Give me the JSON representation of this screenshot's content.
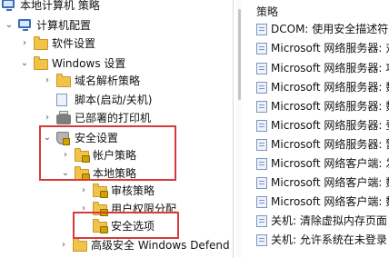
{
  "tree": {
    "root": "本地计算机 策略",
    "computer_config": "计算机配置",
    "software_settings": "软件设置",
    "windows_settings": "Windows 设置",
    "dns_policy": "域名解析策略",
    "scripts": "脚本(启动/关机)",
    "printers": "已部署的打印机",
    "security_settings": "安全设置",
    "account_policies": "帐户策略",
    "local_policies": "本地策略",
    "audit_policy": "审核策略",
    "user_rights": "用户权限分配",
    "security_options": "安全选项",
    "advanced_firewall": "高级安全 Windows Defend"
  },
  "right_panel": {
    "header": "策略",
    "items": [
      "DCOM: 使用安全描述符",
      "Microsoft 网络服务器: 对",
      "Microsoft 网络服务器: 攻",
      "Microsoft 网络服务器: 数",
      "Microsoft 网络服务器: 数",
      "Microsoft 网络服务器: 登",
      "Microsoft 网络服务器: 暂",
      "Microsoft 网络客户端: 发",
      "Microsoft 网络客户端: 数",
      "Microsoft 网络客户端: 数",
      "关机: 清除虚拟内存页面",
      "关机: 允许系统在未登录"
    ]
  },
  "colors": {
    "highlight": "#d83a3a",
    "folder": "#f2c349"
  }
}
